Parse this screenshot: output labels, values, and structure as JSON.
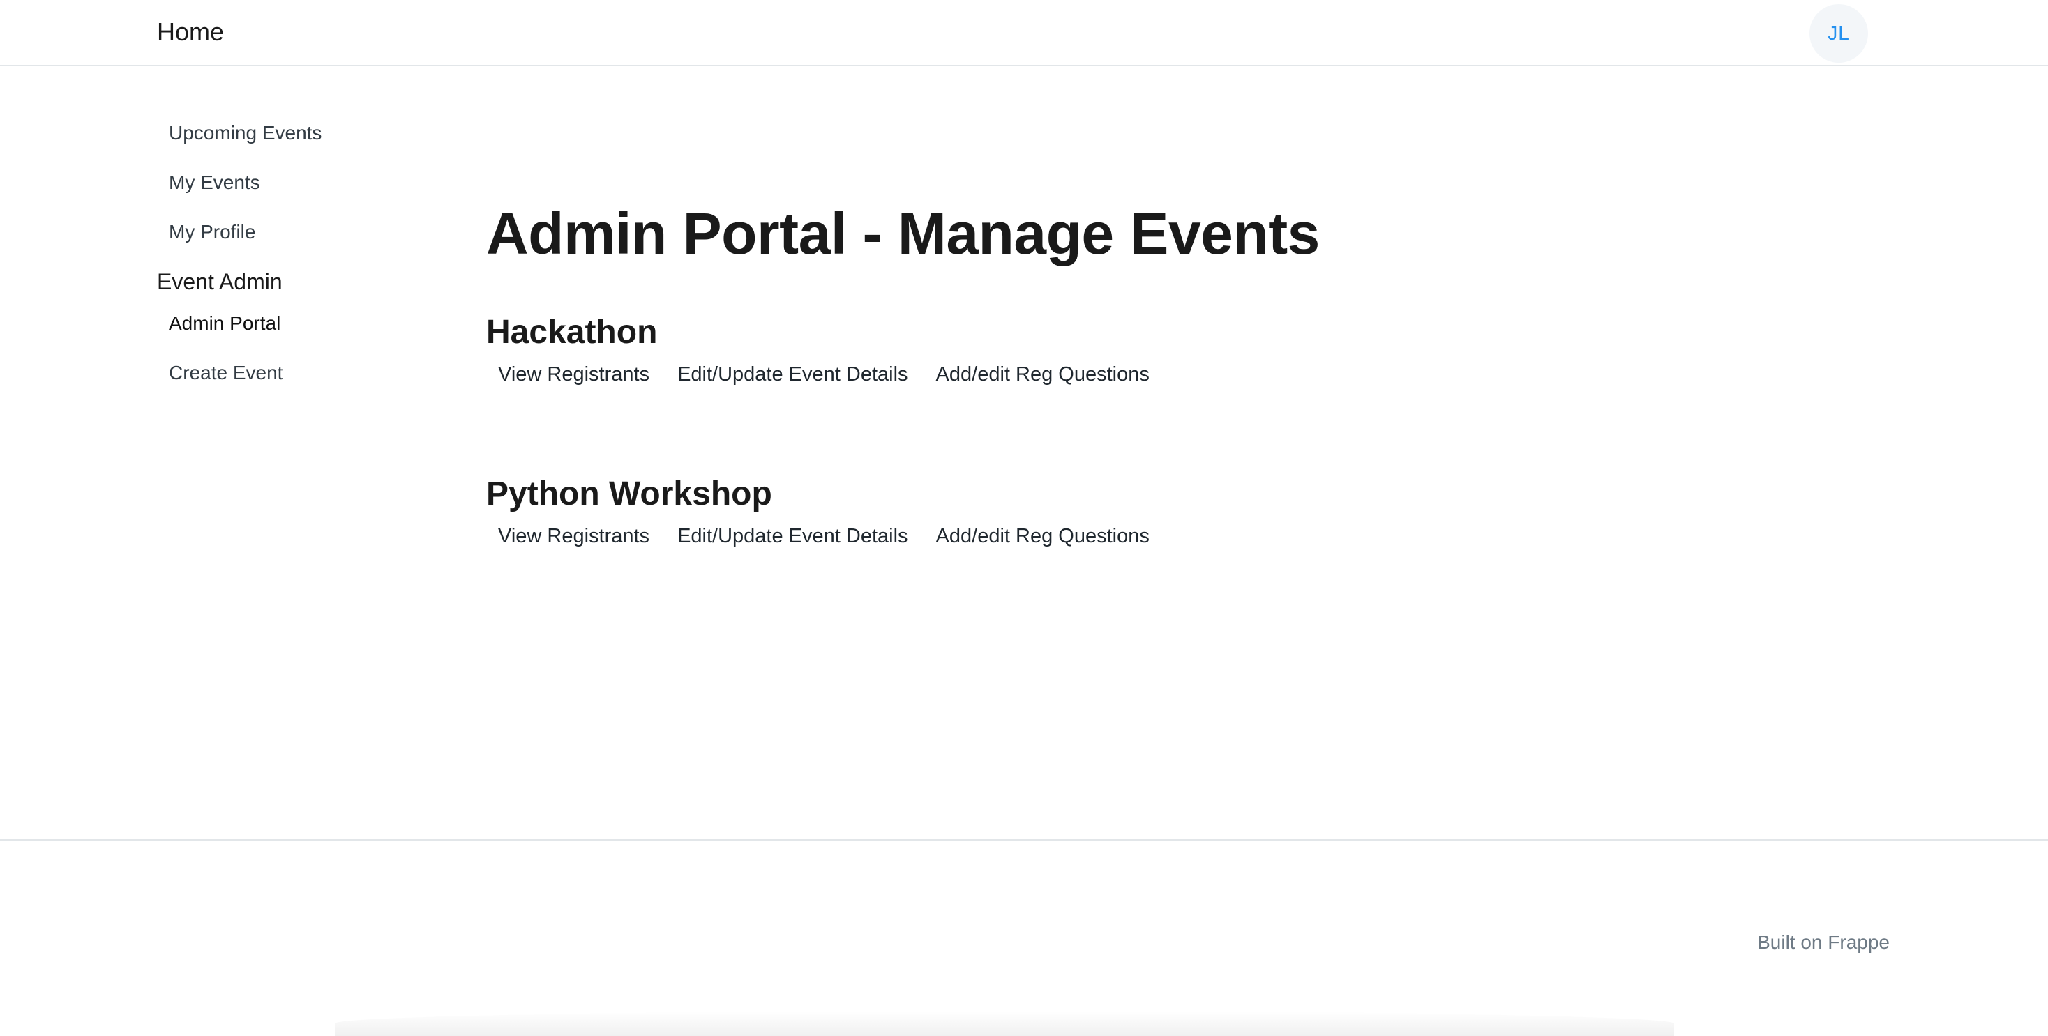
{
  "navbar": {
    "brand": "Home",
    "avatar_initials": "JL"
  },
  "sidebar": {
    "items": [
      {
        "label": "Upcoming Events"
      },
      {
        "label": "My Events"
      },
      {
        "label": "My Profile"
      }
    ],
    "section_title": "Event Admin",
    "admin_items": [
      {
        "label": "Admin Portal"
      },
      {
        "label": "Create Event"
      }
    ]
  },
  "main": {
    "title": "Admin Portal - Manage Events",
    "events": [
      {
        "name": "Hackathon",
        "actions": [
          "View Registrants",
          "Edit/Update Event Details",
          "Add/edit Reg Questions"
        ]
      },
      {
        "name": "Python Workshop",
        "actions": [
          "View Registrants",
          "Edit/Update Event Details",
          "Add/edit Reg Questions"
        ]
      }
    ]
  },
  "footer": {
    "text": "Built on Frappe"
  },
  "colors": {
    "avatar_text": "#2490ef",
    "avatar_bg": "#f3f6f9",
    "divider": "#e2e6e9"
  }
}
